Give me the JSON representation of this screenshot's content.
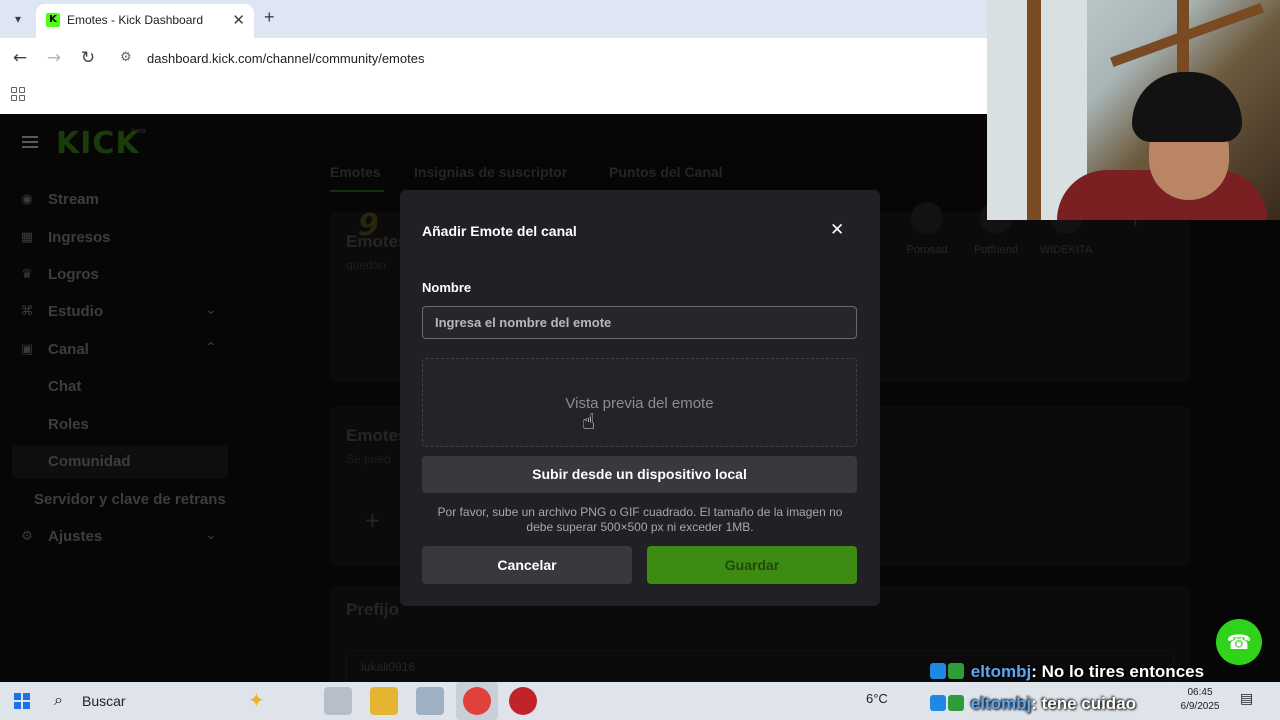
{
  "browser": {
    "tab_title": "Emotes - Kick Dashboard",
    "url": "dashboard.kick.com/channel/community/emotes"
  },
  "sidebar": {
    "logo": "KICK",
    "logo_badge": "beta",
    "items": [
      {
        "label": "Stream",
        "icon": "broadcast-icon"
      },
      {
        "label": "Ingresos",
        "icon": "revenue-icon"
      },
      {
        "label": "Logros",
        "icon": "trophy-icon"
      },
      {
        "label": "Estudio",
        "icon": "studio-icon"
      },
      {
        "label": "Canal",
        "icon": "channel-icon"
      },
      {
        "label": "Chat"
      },
      {
        "label": "Roles"
      },
      {
        "label": "Comunidad"
      },
      {
        "label": "Servidor y clave de retrans"
      },
      {
        "label": "Ajustes",
        "icon": "gear-icon"
      }
    ]
  },
  "content": {
    "tabs": [
      "Emotes",
      "Insignias de suscriptor",
      "Puntos del Canal"
    ],
    "card1_title": "Emotes",
    "card1_sub": "quedan",
    "emote_first": "9",
    "emotes": [
      "Porosad",
      "Potfriend",
      "WIDEKITA"
    ],
    "card2_title": "Emotes",
    "card2_sub": "Se pued",
    "prefix_title": "Prefijo",
    "prefix_value": "lukali0916"
  },
  "modal": {
    "title": "Añadir Emote del canal",
    "name_label": "Nombre",
    "name_placeholder": "Ingresa el nombre del emote",
    "preview_text": "Vista previa del emote",
    "upload_label": "Subir desde un dispositivo local",
    "help_text": "Por favor, sube un archivo PNG o GIF cuadrado. El tamaño de la imagen no debe superar 500×500 px ni exceder 1MB.",
    "cancel_label": "Cancelar",
    "save_label": "Guardar"
  },
  "chat_overlay": [
    {
      "user": "eltombj",
      "message": ": No lo tires entonces"
    },
    {
      "user": "eltombj",
      "message": ": tene cuidao"
    }
  ],
  "taskbar": {
    "search_label": "Buscar",
    "weather": "6°C",
    "time": "06:45",
    "date": "6/9/2025"
  },
  "colors": {
    "kick_green": "#53fc18",
    "save_green": "#3d8b12",
    "modal_bg": "#202124"
  }
}
